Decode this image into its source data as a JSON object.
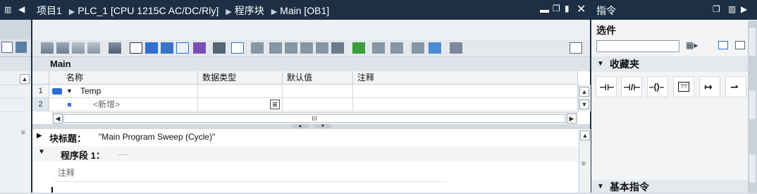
{
  "breadcrumb": {
    "project": "项目1",
    "plc": "PLC_1 [CPU 1215C AC/DC/Rly]",
    "folder": "程序块",
    "block": "Main [OB1]"
  },
  "block_name": "Main",
  "interface_table": {
    "headers": [
      "名称",
      "数据类型",
      "默认值",
      "注释"
    ],
    "rows": [
      {
        "num": "1",
        "name": "Temp"
      },
      {
        "num": "2",
        "name": "<新增>"
      }
    ],
    "scroll_mid": "III"
  },
  "block_title": {
    "label": "块标题：",
    "value": "\"Main Program Sweep (Cycle)\""
  },
  "network": {
    "label": "程序段 1：",
    "dots": ".....",
    "comment_placeholder": "注释"
  },
  "right_panel": {
    "title": "指令",
    "options_label": "选件",
    "favorites_label": "收藏夹",
    "basic_instructions_label": "基本指令"
  },
  "colors": {
    "title_bar": "#1d2f45",
    "workspace_bg": "#eef1f4",
    "accent_blue": "#2f6fd1"
  }
}
